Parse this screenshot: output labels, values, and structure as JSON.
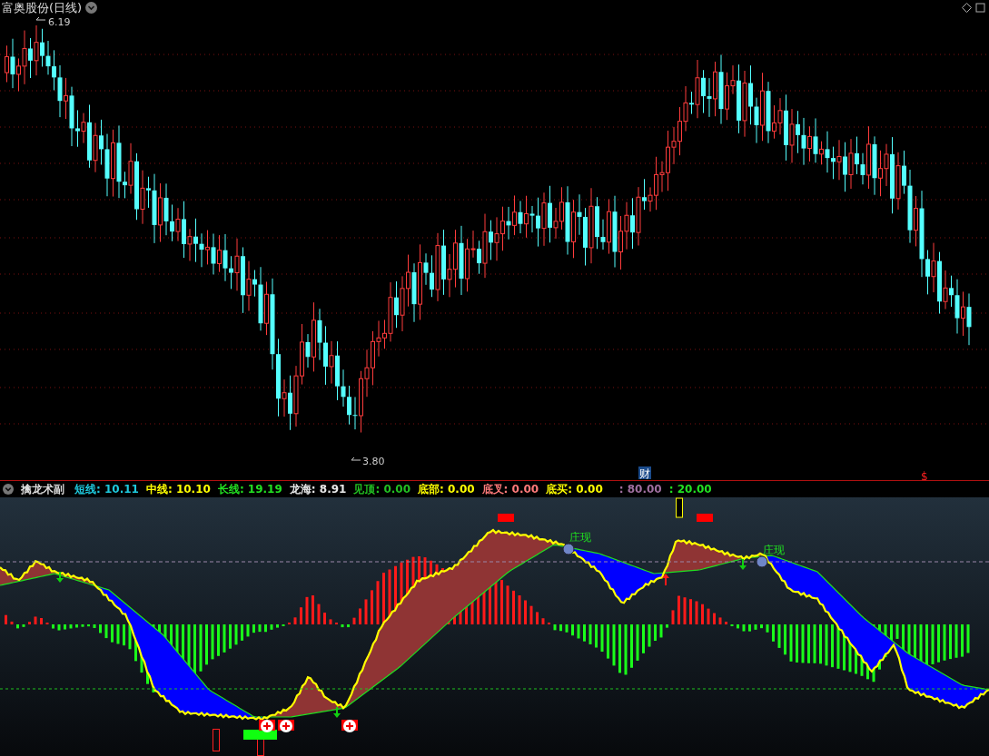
{
  "window": {
    "title": "富奥股份(日线)"
  },
  "price_chart": {
    "high_label": "6.19",
    "low_label": "3.80",
    "markers": [
      {
        "kind": "finance",
        "text": "财"
      },
      {
        "kind": "dividend",
        "text": "$"
      }
    ]
  },
  "indicator": {
    "name": "擒龙术副",
    "readings": [
      {
        "label": "短线:",
        "value": "10.11",
        "color": "#1ec8dc"
      },
      {
        "label": "中线:",
        "value": "10.10",
        "color": "#ffff00"
      },
      {
        "label": "长线:",
        "value": "19.19",
        "color": "#22e022"
      },
      {
        "label": "龙海:",
        "value": "8.91",
        "color": "#e8e8e8"
      },
      {
        "label": "见顶:",
        "value": "0.00",
        "color": "#22c022"
      },
      {
        "label": "底部:",
        "value": "0.00",
        "color": "#ffff00"
      },
      {
        "label": "底叉:",
        "value": "0.00",
        "color": "#ff7a7a"
      },
      {
        "label": "底买:",
        "value": "0.00",
        "color": "#ffff00"
      },
      {
        "label": ":",
        "value": "80.00",
        "color": "#a070a0"
      },
      {
        "label": ":",
        "value": "20.00",
        "color": "#22e022"
      }
    ],
    "signals": [
      {
        "text": "庄现"
      },
      {
        "text": "庄现"
      }
    ]
  }
}
